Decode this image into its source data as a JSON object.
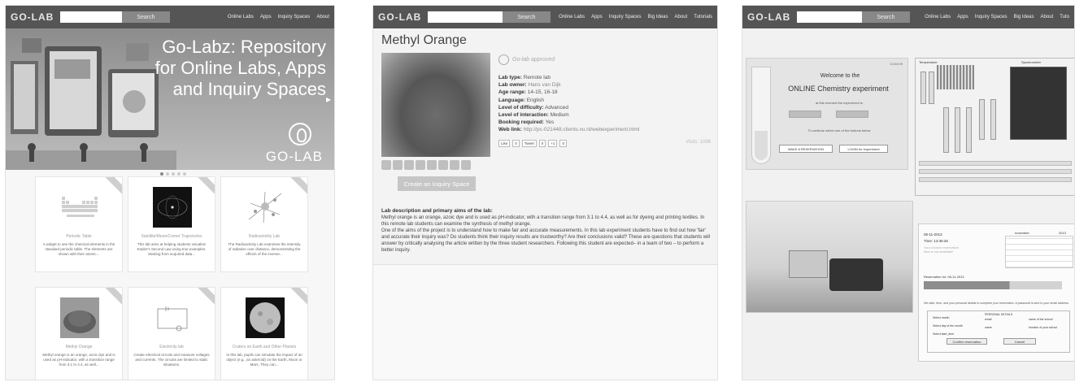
{
  "panels": {
    "left": {
      "header": {
        "logo": "GO-LAB",
        "search_button": "Search",
        "nav": [
          "Online Labs",
          "Apps",
          "Inquiry Spaces",
          "About"
        ]
      },
      "hero": {
        "title": "Go-Labz: Repository for Online Labs, Apps and Inquiry Spaces",
        "logo_text": "GO-LAB"
      },
      "cards": [
        {
          "title": "Periodic Table",
          "desc": "A widget to see the chemical elements in the standard periodic table. The elements are shown with their atomic..."
        },
        {
          "title": "Satellite/Moon/Comet Trajectories",
          "desc": "This lab aims at helping students visualise Kepler's Second Law using true examples. Starting from acquired data..."
        },
        {
          "title": "Radioactivity Lab",
          "desc": "The Radioactivity Lab examines the intensity of radiation over distance, demonstrating the effects of the inverse..."
        },
        {
          "title": "Methyl Orange",
          "desc": "Methyl orange is an orange, azoic dye and is used as pH-indicator, with a transition range from 3.1 to 4.4, as well..."
        },
        {
          "title": "Electricity lab",
          "desc": "Create electrical circuits and measure voltages and currents. The circuits are limited to static situations."
        },
        {
          "title": "Craters on Earth and Other Planets",
          "desc": "In this lab, pupils can simulate the impact of an object (e.g., an asteroid) on the Earth, Moon or Mars. They can..."
        }
      ]
    },
    "middle": {
      "header": {
        "logo": "GO-LAB",
        "search_button": "Search",
        "nav": [
          "Online Labs",
          "Apps",
          "Inquiry Spaces",
          "Big Ideas",
          "About",
          "Tutorials"
        ]
      },
      "title": "Methyl Orange",
      "approved": "Go-lab approved",
      "properties": [
        {
          "key": "Lab type:",
          "value": "Remote lab"
        },
        {
          "key": "Lab owner:",
          "value": "Hans van Dijk"
        },
        {
          "key": "Age range:",
          "value": "14-15, 16-18"
        },
        {
          "key": "Language:",
          "value": "English"
        },
        {
          "key": "Level of difficulty:",
          "value": "Advanced"
        },
        {
          "key": "Level of interaction:",
          "value": "Medium"
        },
        {
          "key": "Booking required:",
          "value": "Yes"
        },
        {
          "key": "Web link:",
          "value": "http://pc-021448.clients.vu.nl/webexperiment.html"
        }
      ],
      "social": [
        "Like",
        "0",
        "Tweet",
        "0",
        "+1",
        "0"
      ],
      "visits": "Visits: 1096",
      "create_button": "Create an Inquiry Space",
      "description": {
        "heading": "Lab description and primary aims of the lab:",
        "para1": "Methyl orange is an orange, azoic dye and is used as pH-indicator, with a transition range from 3.1 to 4.4, as well as for dyeing and printing textiles. In this remote lab students can examine the synthesis of methyl orange.",
        "para2": "One of the aims of the project is to understand how to make fair and accurate measurements. In this lab experiment students have to find out how 'fair' and accurate their inquiry was? Do students think their inquiry results are trustworthy? Are their conclusions valid? These are questions that students will answer by critically analysing the article written by the three student researchers. Following this student are expected– in a team of two – to perform a better inquiry."
      }
    },
    "right": {
      "header": {
        "logo": "GO-LAB",
        "search_button": "Search",
        "nav": [
          "Online Labs",
          "Apps",
          "Inquiry Spaces",
          "Big Ideas",
          "About",
          "Tuto"
        ]
      },
      "welcome": {
        "time": "13:34:09",
        "title": "Welcome to the",
        "subtitle": "ONLINE Chemistry experiment",
        "note": "at this moment the experiment is",
        "continue": "To continue select one of the buttons below",
        "reserve_button": "MAKE A RESERVATION",
        "login_button": "LOGIN for experiment"
      },
      "rig": {
        "temperature": "Temperature",
        "spectrometer": "Spectrometer"
      },
      "reservation": {
        "date": "06-11-2013",
        "time": "Time: 13:36:26",
        "note": "Your chosen reservation time is not available!",
        "month": "november",
        "year": "2013",
        "reservation_for": "Reservation for: 06-11-2013",
        "hint": "Set date, time, and your personal details to complete your reservation. A password is sent to your email address.",
        "fields": [
          "Select month",
          "Select day of the month",
          "Select start_time",
          "PERSONAL DETAILS",
          "email",
          "name of the school",
          "name",
          "function of your school"
        ],
        "confirm_button": "Confirm reservation",
        "cancel_button": "Cancel"
      }
    }
  }
}
